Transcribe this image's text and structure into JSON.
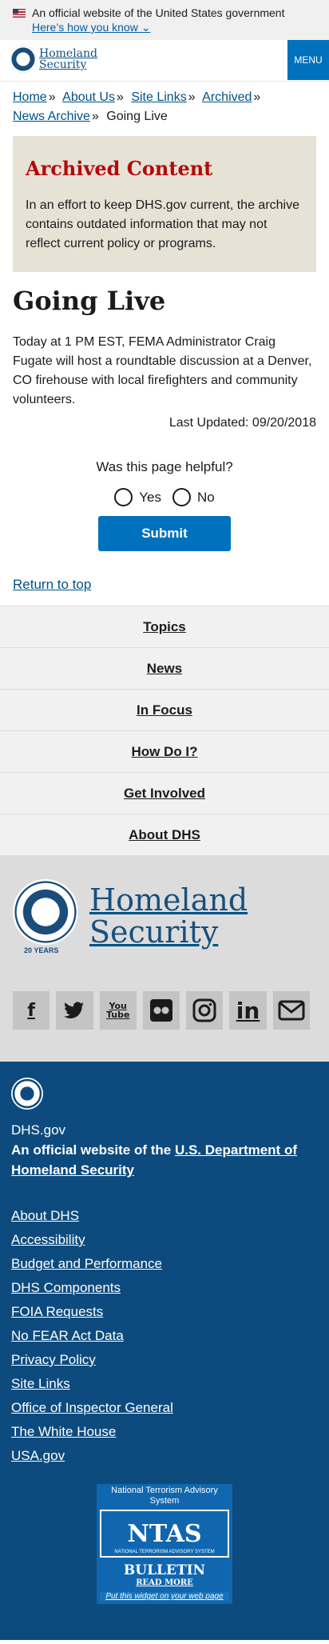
{
  "gov_banner": {
    "text": "An official website of the United States government",
    "link": "Here’s how you know ⌄"
  },
  "header": {
    "logo_line1": "Homeland",
    "logo_line2": "Security",
    "menu_label": "MENU"
  },
  "breadcrumb": {
    "items": [
      "Home",
      "About Us",
      "Site Links",
      "Archived",
      "News Archive"
    ],
    "sep": "»",
    "current": "Going Live"
  },
  "archived": {
    "title": "Archived Content",
    "text": "In an effort to keep DHS.gov current, the archive contains outdated information that may not reflect current policy or programs."
  },
  "article": {
    "title": "Going Live",
    "body": "Today at 1 PM EST, FEMA Administrator Craig Fugate will host a roundtable discussion at a Denver, CO firehouse with local firefighters and community volunteers.",
    "last_updated": "Last Updated: 09/20/2018"
  },
  "feedback": {
    "question": "Was this page helpful?",
    "yes": "Yes",
    "no": "No",
    "submit": "Submit"
  },
  "return_top": "Return to top",
  "footer_nav": [
    "Topics",
    "News",
    "In Focus",
    "How Do I?",
    "Get Involved",
    "About DHS"
  ],
  "footer_logo": {
    "line1": "Homeland",
    "line2": "Security",
    "years": "20 YEARS"
  },
  "socials": [
    {
      "icon": "facebook-icon",
      "glyph": "f"
    },
    {
      "icon": "twitter-icon",
      "glyph": "🐦"
    },
    {
      "icon": "youtube-icon",
      "glyph": "You Tube"
    },
    {
      "icon": "flickr-icon",
      "glyph": "●●"
    },
    {
      "icon": "instagram-icon",
      "glyph": "◎"
    },
    {
      "icon": "linkedin-icon",
      "glyph": "in"
    },
    {
      "icon": "email-icon",
      "glyph": "✉"
    }
  ],
  "footer": {
    "site": "DHS.gov",
    "official_prefix": "An official website of the ",
    "official_link": "U.S. Department of Homeland Security",
    "links": [
      "About DHS",
      "Accessibility",
      "Budget and Performance",
      "DHS Components",
      "FOIA Requests",
      "No FEAR Act Data",
      "Privacy Policy",
      "Site Links",
      "Office of Inspector General",
      "The White House",
      "USA.gov"
    ]
  },
  "ntas": {
    "title": "National Terrorism Advisory System",
    "badge": "NTAS",
    "badge_sub": "NATIONAL TERRORISM ADVISORY SYSTEM",
    "bulletin": "BULLETIN",
    "read_more": "READ MORE",
    "widget": "Put this widget on your web page"
  }
}
